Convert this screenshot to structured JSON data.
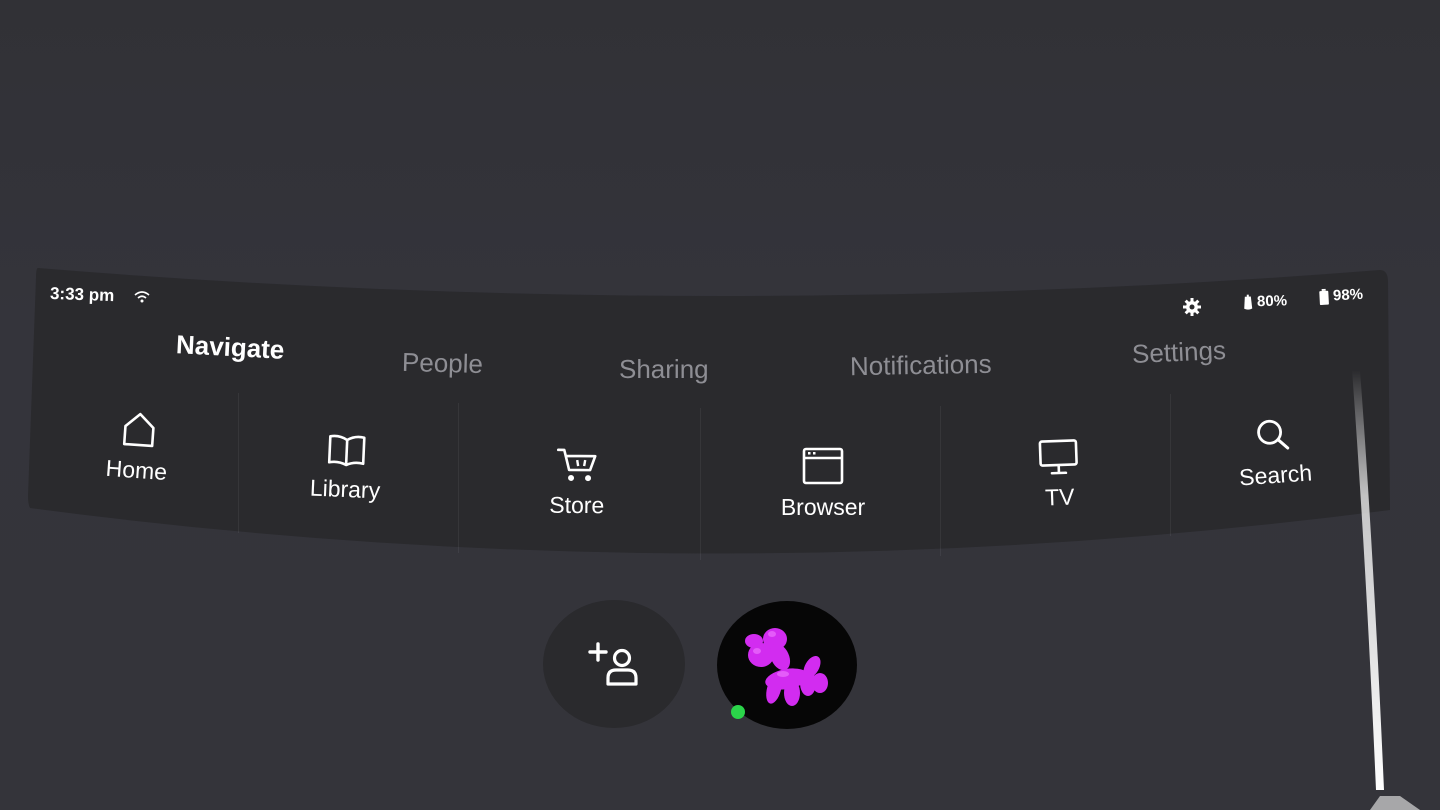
{
  "status": {
    "time": "3:33 pm",
    "controller_battery": "80%",
    "headset_battery": "98%"
  },
  "tabs": [
    {
      "label": "Navigate",
      "active": true
    },
    {
      "label": "People",
      "active": false
    },
    {
      "label": "Sharing",
      "active": false
    },
    {
      "label": "Notifications",
      "active": false
    },
    {
      "label": "Settings",
      "active": false
    }
  ],
  "nav": [
    {
      "label": "Home",
      "icon": "home-icon"
    },
    {
      "label": "Library",
      "icon": "book-icon"
    },
    {
      "label": "Store",
      "icon": "cart-icon"
    },
    {
      "label": "Browser",
      "icon": "browser-window-icon"
    },
    {
      "label": "TV",
      "icon": "monitor-icon"
    },
    {
      "label": "Search",
      "icon": "search-icon"
    }
  ],
  "colors": {
    "background": "#34343a",
    "panel": "#2a2a2d",
    "active_tab": "#ffffff",
    "inactive_tab": "#8e8e94",
    "online_indicator": "#2bd44a",
    "avatar_accent": "#d22cf0"
  },
  "bottom": {
    "add_friend_icon": "add-person-icon",
    "avatar_icon": "balloon-dog-avatar",
    "avatar_online": true
  }
}
